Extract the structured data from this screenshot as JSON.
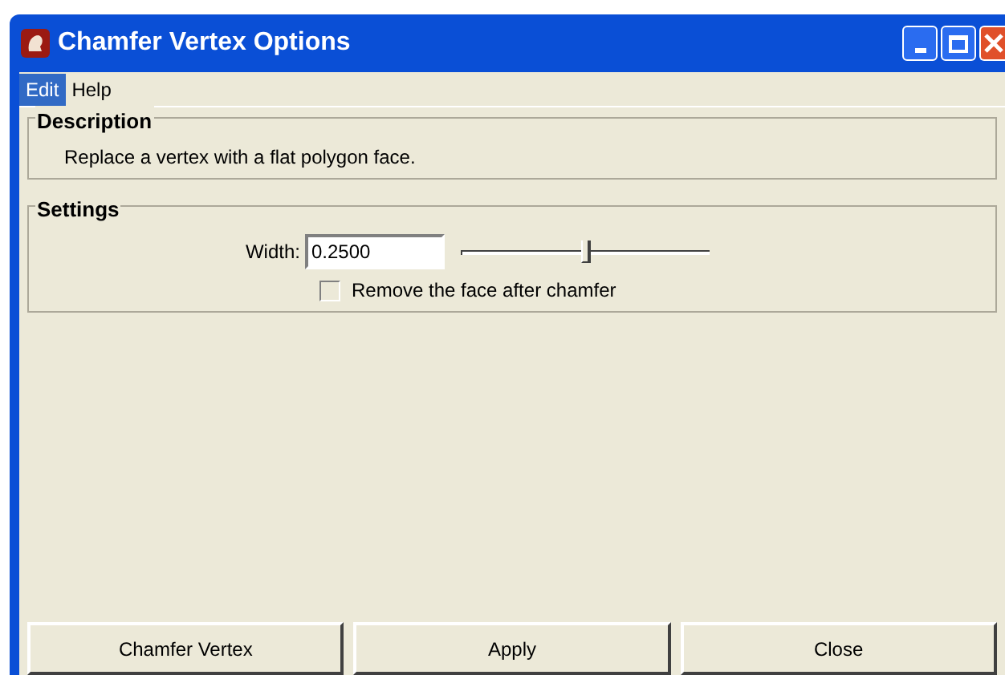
{
  "window": {
    "title": "Chamfer Vertex Options"
  },
  "menu": [
    {
      "label": "Edit",
      "selected": true
    },
    {
      "label": "Help",
      "selected": false
    }
  ],
  "description": {
    "title": "Description",
    "text": "Replace a vertex with a flat polygon face."
  },
  "settings": {
    "title": "Settings",
    "width_label": "Width:",
    "width_value": "0.2500",
    "width_slider": {
      "level": 0.5
    },
    "remove_face": {
      "label": "Remove the face after chamfer",
      "checked": false
    }
  },
  "buttons": [
    "Chamfer Vertex",
    "Apply",
    "Close"
  ]
}
